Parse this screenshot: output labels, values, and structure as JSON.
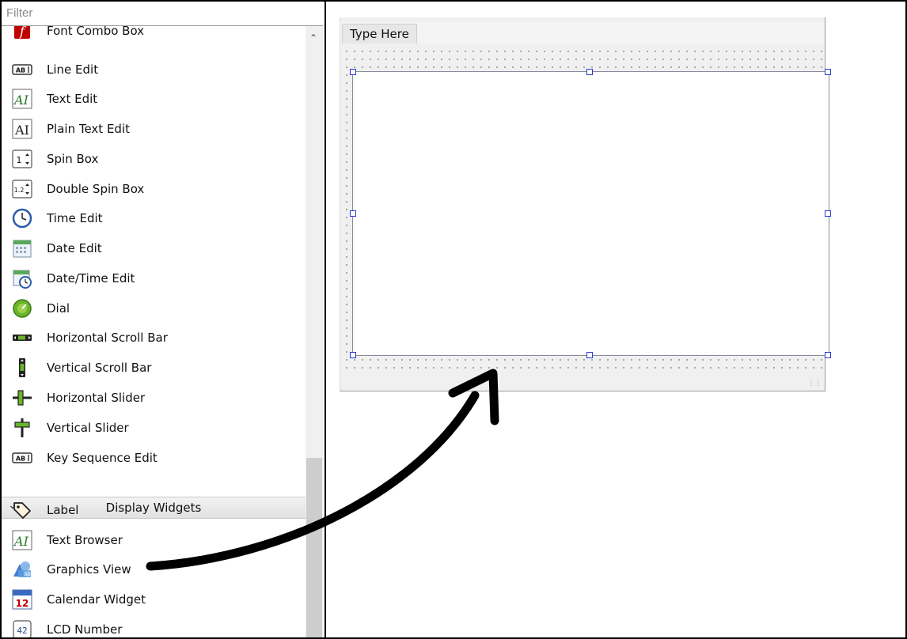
{
  "filter": {
    "placeholder": "Filter"
  },
  "widget_box": {
    "items": [
      {
        "label": "Font Combo Box",
        "icon": "font-combo-box-icon"
      },
      {
        "label": "Line Edit",
        "icon": "line-edit-icon"
      },
      {
        "label": "Text Edit",
        "icon": "text-edit-icon"
      },
      {
        "label": "Plain Text Edit",
        "icon": "plain-text-edit-icon"
      },
      {
        "label": "Spin Box",
        "icon": "spin-box-icon"
      },
      {
        "label": "Double Spin Box",
        "icon": "double-spin-box-icon"
      },
      {
        "label": "Time Edit",
        "icon": "time-edit-icon"
      },
      {
        "label": "Date Edit",
        "icon": "date-edit-icon"
      },
      {
        "label": "Date/Time Edit",
        "icon": "datetime-edit-icon"
      },
      {
        "label": "Dial",
        "icon": "dial-icon"
      },
      {
        "label": "Horizontal Scroll Bar",
        "icon": "horizontal-scroll-bar-icon"
      },
      {
        "label": "Vertical Scroll Bar",
        "icon": "vertical-scroll-bar-icon"
      },
      {
        "label": "Horizontal Slider",
        "icon": "horizontal-slider-icon"
      },
      {
        "label": "Vertical Slider",
        "icon": "vertical-slider-icon"
      },
      {
        "label": "Key Sequence Edit",
        "icon": "key-sequence-edit-icon"
      }
    ],
    "category": {
      "label": "Display Widgets"
    },
    "display_items": [
      {
        "label": "Label",
        "icon": "label-icon"
      },
      {
        "label": "Text Browser",
        "icon": "text-browser-icon"
      },
      {
        "label": "Graphics View",
        "icon": "graphics-view-icon"
      },
      {
        "label": "Calendar Widget",
        "icon": "calendar-widget-icon"
      },
      {
        "label": "LCD Number",
        "icon": "lcd-number-icon"
      }
    ]
  },
  "form": {
    "menu_placeholder": "Type Here"
  },
  "colors": {
    "selection_handle": "#2a3bd4",
    "arrow": "#000000"
  }
}
